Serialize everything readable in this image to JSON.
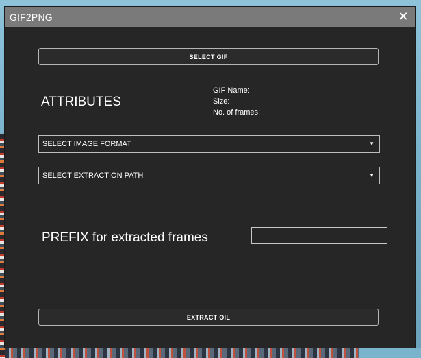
{
  "window": {
    "title": "GIF2PNG",
    "close_glyph": "✕"
  },
  "buttons": {
    "select_gif": "SELECT GIF",
    "extract": "EXTRACT OIL"
  },
  "attributes": {
    "heading": "ATTRIBUTES",
    "gif_name_label": "GIF Name:",
    "size_label": "Size:",
    "frames_label": "No. of frames:"
  },
  "dropdowns": {
    "image_format": {
      "selected": "SELECT IMAGE FORMAT",
      "arrow": "▼"
    },
    "extraction_path": {
      "selected": "SELECT EXTRACTION PATH",
      "arrow": "▼"
    }
  },
  "prefix": {
    "label": "PREFIX for extracted frames",
    "value": "",
    "placeholder": ""
  },
  "icons": {
    "close": "close-icon",
    "dropdown_arrow": "chevron-down-icon"
  },
  "colors": {
    "window_bg": "#262626",
    "titlebar_bg": "#7a7a7a",
    "text": "#ffffff",
    "border": "#b5b5b5"
  }
}
